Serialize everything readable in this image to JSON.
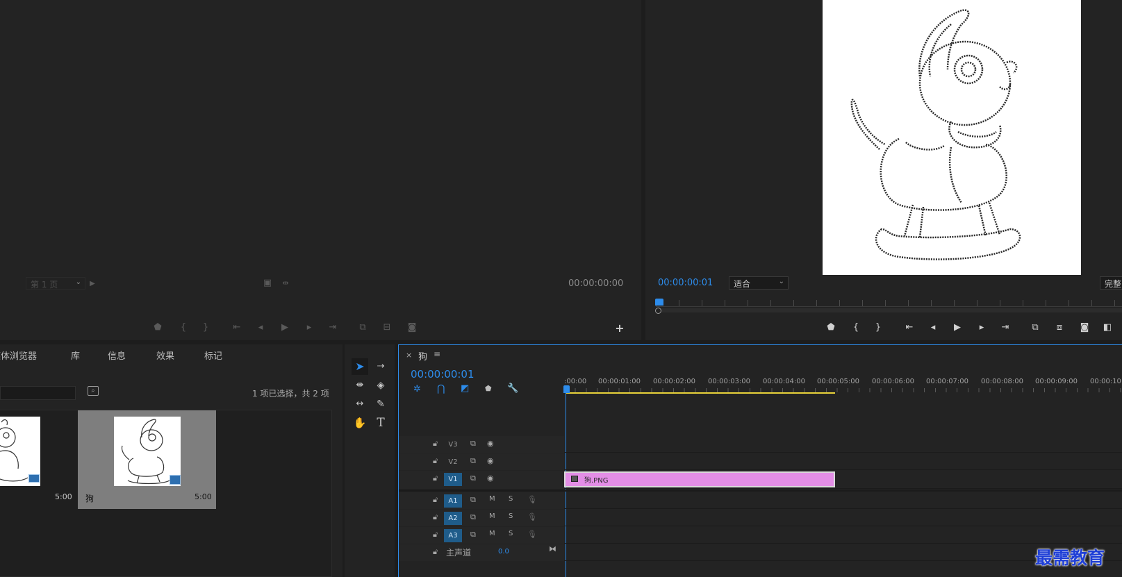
{
  "source_monitor": {
    "page_select": "第 1 页",
    "timecode": "00:00:00:00"
  },
  "program_monitor": {
    "timecode": "00:00:00:01",
    "fit_select": "适合",
    "quality_select": "完整"
  },
  "project_panel": {
    "tabs": [
      "媒体浏览器",
      "库",
      "信息",
      "效果",
      "标记"
    ],
    "search_placeholder": "",
    "selection_status": "1 项已选择，共 2 项",
    "items": [
      {
        "name": "",
        "duration": "5:00"
      },
      {
        "name": "狗",
        "duration": "5:00"
      }
    ]
  },
  "timeline": {
    "close_label": "×",
    "sequence_name": "狗",
    "menu_label": "≡",
    "timecode": "00:00:00:01",
    "ruler_labels": [
      ":00:00",
      "00:00:01:00",
      "00:00:02:00",
      "00:00:03:00",
      "00:00:04:00",
      "00:00:05:00",
      "00:00:06:00",
      "00:00:07:00",
      "00:00:08:00",
      "00:00:09:00",
      "00:00:10:"
    ],
    "video_tracks": [
      "V3",
      "V2",
      "V1"
    ],
    "audio_tracks": [
      "A1",
      "A2",
      "A3"
    ],
    "audio_buttons": {
      "mute": "M",
      "solo": "S"
    },
    "master_label": "主声道",
    "master_value": "0.0",
    "clip_name": "狗.PNG"
  },
  "watermark": "最需教育",
  "colors": {
    "accent_blue": "#2d8ceb",
    "clip_pink": "#e38ee6",
    "work_area_yellow": "#e8d23a"
  }
}
